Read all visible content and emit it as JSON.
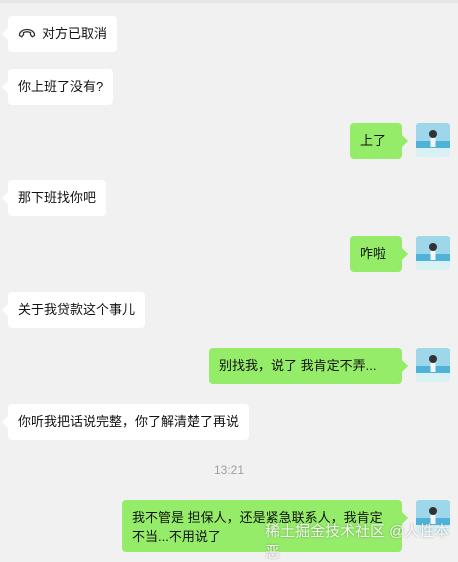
{
  "messages": [
    {
      "side": "left",
      "text": "对方已取消",
      "icon": "hangup-phone-icon"
    },
    {
      "side": "left",
      "text": "你上班了没有?"
    },
    {
      "side": "right",
      "text": "上了"
    },
    {
      "side": "left",
      "text": "那下班找你吧"
    },
    {
      "side": "right",
      "text": "咋啦"
    },
    {
      "side": "left",
      "text": "关于我贷款这个事儿"
    },
    {
      "side": "right",
      "text": "别找我，说了 我肯定不弄..."
    },
    {
      "side": "left",
      "text": "你听我把话说完整，你了解清楚了再说"
    },
    {
      "side": "right",
      "text": "我不管是 担保人，还是紧急联系人，我肯定不当...不用说了"
    }
  ],
  "timestamp": "13:21",
  "watermark": "稀土掘金技术社区 @人性本恶",
  "colors": {
    "background": "#f1f1f1",
    "left_bubble": "#ffffff",
    "right_bubble": "#95ec69",
    "timestamp": "#a0a0a0"
  }
}
